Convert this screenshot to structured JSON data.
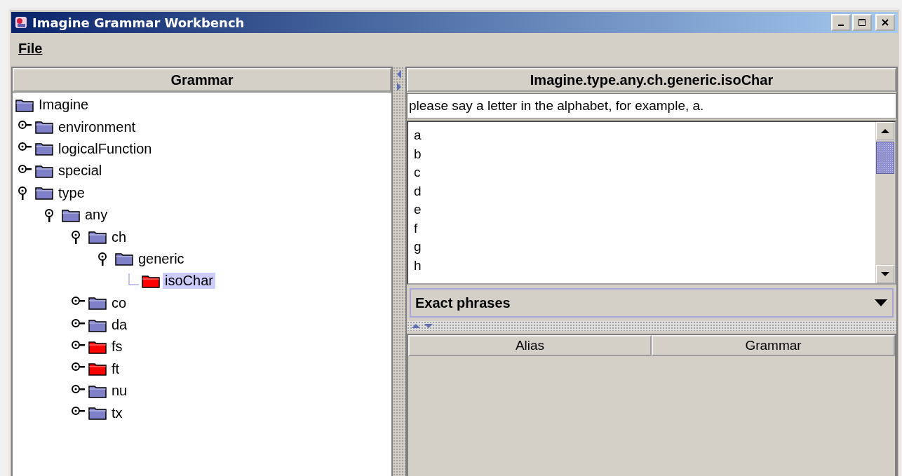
{
  "window": {
    "title": "Imagine Grammar Workbench"
  },
  "menu": [
    {
      "label": "File"
    }
  ],
  "left_panel": {
    "header": "Grammar",
    "tree": [
      {
        "label": "Imagine",
        "color": "#8080c8",
        "selected": false,
        "children": [
          {
            "label": "environment",
            "color": "#8080c8",
            "selected": false,
            "expanded": false
          },
          {
            "label": "logicalFunction",
            "color": "#8080c8",
            "selected": false,
            "expanded": false
          },
          {
            "label": "special",
            "color": "#8080c8",
            "selected": false,
            "expanded": false
          },
          {
            "label": "type",
            "color": "#8080c8",
            "selected": false,
            "expanded": true,
            "children": [
              {
                "label": "any",
                "color": "#8080c8",
                "selected": false,
                "expanded": true,
                "children": [
                  {
                    "label": "ch",
                    "color": "#8080c8",
                    "selected": false,
                    "expanded": true,
                    "children": [
                      {
                        "label": "generic",
                        "color": "#8080c8",
                        "selected": false,
                        "expanded": true,
                        "children": [
                          {
                            "label": "isoChar",
                            "color": "#ff0000",
                            "selected": true
                          }
                        ]
                      }
                    ]
                  },
                  {
                    "label": "co",
                    "color": "#8080c8",
                    "selected": false,
                    "expanded": false
                  },
                  {
                    "label": "da",
                    "color": "#8080c8",
                    "selected": false,
                    "expanded": false
                  },
                  {
                    "label": "fs",
                    "color": "#ff0000",
                    "selected": false,
                    "expanded": false
                  },
                  {
                    "label": "ft",
                    "color": "#ff0000",
                    "selected": false,
                    "expanded": false
                  },
                  {
                    "label": "nu",
                    "color": "#8080c8",
                    "selected": false,
                    "expanded": false
                  },
                  {
                    "label": "tx",
                    "color": "#8080c8",
                    "selected": false,
                    "expanded": false
                  }
                ]
              }
            ]
          }
        ]
      }
    ]
  },
  "right_panel": {
    "header": "Imagine.type.any.ch.generic.isoChar",
    "prompt": {
      "value": "please say a letter in the alphabet, for example, a."
    },
    "phrases": [
      "a",
      "b",
      "c",
      "d",
      "e",
      "f",
      "g",
      "h"
    ],
    "dropdown": {
      "value": "Exact phrases"
    },
    "table": {
      "columns": [
        "Alias",
        "Grammar"
      ]
    }
  }
}
